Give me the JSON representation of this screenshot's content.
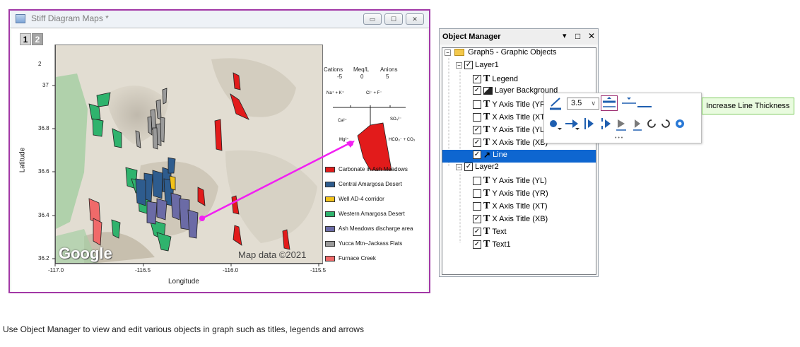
{
  "graph_window": {
    "title": "Stiff Diagram Maps *",
    "layer_tabs": [
      "1",
      "2"
    ],
    "buttons": [
      "▭",
      "☐",
      "✕"
    ]
  },
  "map": {
    "google_logo": "Google",
    "attribution": "Map data ©2021",
    "y_axis_label": "Latitude",
    "x_axis_label": "Longitude",
    "y_ticks": [
      "37",
      "36.8",
      "36.6",
      "36.4",
      "36.2"
    ],
    "x_ticks": [
      "-117.0",
      "-116.5",
      "-116.0",
      "-115.5"
    ],
    "top_tick": "2"
  },
  "stiff_key": {
    "cations": "Cations",
    "meq": "Meq/L",
    "anions": "Anions",
    "scale": [
      "-5",
      "0",
      "5"
    ],
    "na_k": "Na⁺ + K⁺",
    "cl_f": "Cl⁻ + F⁻",
    "ca": "Ca²⁺",
    "so4": "SO₄²⁻",
    "mg": "Mg²⁺",
    "hco3": "HCO₃⁻ + CO₃"
  },
  "legend": [
    {
      "label": "Carbonate in Ash Meadows",
      "color": "#e21b1b"
    },
    {
      "label": "Central Amargosa Desert",
      "color": "#2e5c8e"
    },
    {
      "label": "Well AD-4 corridor",
      "color": "#f2c21b"
    },
    {
      "label": "Western Amargosa Desert",
      "color": "#2fb36d"
    },
    {
      "label": "Ash Meadows discharge area",
      "color": "#6b6ba6"
    },
    {
      "label": "Yucca Mtn–Jackass Flats",
      "color": "#9a9a9a"
    },
    {
      "label": "Furnace Creek",
      "color": "#f06a6a"
    }
  ],
  "object_manager": {
    "title": "Object Manager",
    "header_controls": [
      "▾",
      "□",
      "✕"
    ],
    "tree": [
      {
        "label": "Graph5 - Graphic Objects",
        "level": 0,
        "type": "folder",
        "expander": "−"
      },
      {
        "label": "Layer1",
        "level": 1,
        "type": "layer",
        "checked": true,
        "expander": "−"
      },
      {
        "label": "Legend",
        "level": 2,
        "type": "text",
        "checked": true
      },
      {
        "label": "Layer Background",
        "level": 2,
        "type": "image",
        "checked": true
      },
      {
        "label": "Y Axis Title (YR)",
        "level": 2,
        "type": "text",
        "checked": false
      },
      {
        "label": "X Axis Title (XT)",
        "level": 2,
        "type": "text",
        "checked": false
      },
      {
        "label": "Y Axis Title (YL)",
        "level": 2,
        "type": "text",
        "checked": true
      },
      {
        "label": "X Axis Title (XB)",
        "level": 2,
        "type": "text",
        "checked": true
      },
      {
        "label": "Line",
        "level": 2,
        "type": "arrow",
        "checked": true,
        "selected": true
      },
      {
        "label": "Layer2",
        "level": 1,
        "type": "layer",
        "checked": true,
        "expander": "−"
      },
      {
        "label": "Y Axis Title (YL)",
        "level": 2,
        "type": "text",
        "checked": false
      },
      {
        "label": "Y Axis Title (YR)",
        "level": 2,
        "type": "text",
        "checked": false
      },
      {
        "label": "X Axis Title (XT)",
        "level": 2,
        "type": "text",
        "checked": false
      },
      {
        "label": "X Axis Title (XB)",
        "level": 2,
        "type": "text",
        "checked": true
      },
      {
        "label": "Text",
        "level": 2,
        "type": "text",
        "checked": true
      },
      {
        "label": "Text1",
        "level": 2,
        "type": "text",
        "checked": true
      }
    ]
  },
  "mini_toolbar": {
    "thickness_value": "3.5",
    "dropdown_arrow": "∨",
    "more": "• • •"
  },
  "tooltip": "Increase Line Thickness",
  "caption": "Use Object Manager to view and edit various objects in graph such as titles, legends and arrows",
  "colors": {
    "window_border": "#a238a6",
    "arrow": "#f21ff2",
    "selection": "#0e66d0",
    "tooltip_bg": "#e9fbdf"
  }
}
